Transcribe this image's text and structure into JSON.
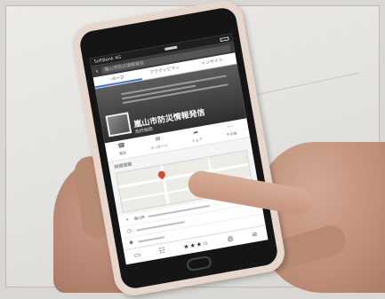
{
  "scene": {
    "description_tags": [
      "wall-background",
      "hands",
      "smartphone"
    ]
  },
  "app": {
    "status_bar": {
      "carrier": "SoftBank 4G",
      "time": "",
      "battery": ""
    },
    "search": {
      "value": "嵐山市防災情報発信",
      "back_icon": "back-arrow-icon"
    },
    "tabs": [
      {
        "label": "ページ",
        "active": true
      },
      {
        "label": "アクティビティ",
        "active": false
      },
      {
        "label": "インサイト",
        "active": false
      }
    ],
    "page": {
      "title": "嵐山市防災情報発信",
      "category": "政府機関"
    },
    "actions": [
      {
        "icon": "phone-icon",
        "label": "電話"
      },
      {
        "icon": "message-icon",
        "label": "メッセージ"
      },
      {
        "icon": "share-icon",
        "label": "シェア"
      },
      {
        "icon": "more-icon",
        "label": "その他"
      }
    ],
    "sections": {
      "details_label": "詳細情報"
    },
    "info_rows": [
      {
        "icon": "location-pin-icon",
        "text": "嵐山市"
      },
      {
        "icon": "clock-icon",
        "text": ""
      },
      {
        "icon": "category-icon",
        "text": ""
      }
    ],
    "bottom_bar": {
      "rating": "★★★☆",
      "icons": [
        "home-icon",
        "friends-icon",
        "globe-icon",
        "menu-icon"
      ]
    }
  }
}
